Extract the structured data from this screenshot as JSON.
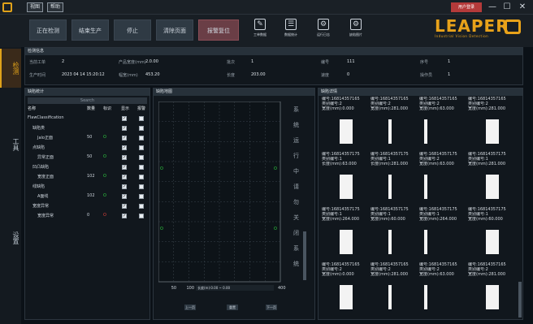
{
  "titlebar": {
    "menu_1": "视图",
    "menu_2": "帮助",
    "user_btn": "用户登录"
  },
  "toolbar": {
    "buttons": [
      "正在检测",
      "结束生产",
      "停止",
      "清除页面",
      "报警复位"
    ],
    "icons": [
      {
        "label": "工单数据",
        "name": "work-order-icon"
      },
      {
        "label": "数据统计",
        "name": "stats-icon"
      },
      {
        "label": "运行日志",
        "name": "log-icon"
      },
      {
        "label": "缺陷图片",
        "name": "defect-image-icon"
      }
    ],
    "brand": "LEAPER",
    "brand_sub": "Industrial Vision Detection",
    "accent": "#e8a21a"
  },
  "sidebar": {
    "tabs": [
      "检测",
      "工具",
      "设置"
    ]
  },
  "info": {
    "title": "检测信息",
    "row1": [
      {
        "k": "当前工单",
        "v": "2"
      },
      {
        "k": "产品宽度(mm)",
        "v": "2.0.00"
      },
      {
        "k": "批次",
        "v": "1"
      },
      {
        "k": "编号",
        "v": "111"
      },
      {
        "k": "序号",
        "v": "1"
      }
    ],
    "row2": [
      {
        "k": "生产时间",
        "v": "2023 04 14 15:20:12"
      },
      {
        "k": "幅宽(mm)",
        "v": "453.20"
      },
      {
        "k": "长度",
        "v": "203.00"
      },
      {
        "k": "速度",
        "v": "0"
      },
      {
        "k": "操作员",
        "v": "1"
      }
    ]
  },
  "stats": {
    "title": "缺陷统计",
    "search": "Search",
    "cols": [
      "名称",
      "数量",
      "标识",
      "显示",
      "报警"
    ],
    "rows": [
      {
        "indent": 0,
        "name": "FlawClassification",
        "count": "",
        "flag": "",
        "show": "✓",
        "alarm": ""
      },
      {
        "indent": 1,
        "name": "缺陷类",
        "count": "",
        "flag": "",
        "show": "✓",
        "alarm": ""
      },
      {
        "indent": 2,
        "name": "Jalo正面",
        "count": "50",
        "flag": "O",
        "flagc": "#2ecc40",
        "show": "✓",
        "alarm": ""
      },
      {
        "indent": 1,
        "name": "点缺陷",
        "count": "",
        "flag": "",
        "show": "✓",
        "alarm": ""
      },
      {
        "indent": 2,
        "name": "异常正面",
        "count": "50",
        "flag": "O",
        "flagc": "#2ecc40",
        "show": "✓",
        "alarm": ""
      },
      {
        "indent": 1,
        "name": "凹凸缺陷",
        "count": "",
        "flag": "",
        "show": "✓",
        "alarm": ""
      },
      {
        "indent": 2,
        "name": "宽度正面",
        "count": "102",
        "flag": "O",
        "flagc": "#2ecc40",
        "show": "✓",
        "alarm": ""
      },
      {
        "indent": 1,
        "name": "线缺陷",
        "count": "",
        "flag": "",
        "show": "✓",
        "alarm": ""
      },
      {
        "indent": 2,
        "name": "A面线",
        "count": "102",
        "flag": "O",
        "flagc": "#2ecc40",
        "show": "✓",
        "alarm": ""
      },
      {
        "indent": 1,
        "name": "宽度异常",
        "count": "",
        "flag": "",
        "show": "✓",
        "alarm": ""
      },
      {
        "indent": 2,
        "name": "宽度异常",
        "count": "0",
        "flag": "O",
        "flagc": "#e0413a",
        "show": "✓",
        "alarm": ""
      }
    ]
  },
  "map": {
    "title": "缺陷地图",
    "xticks": [
      "0",
      "50",
      "100",
      "150",
      "200",
      "250",
      "300",
      "350",
      "400"
    ],
    "marker_o": "O",
    "side_labels": [
      "系",
      "统",
      "运",
      "行",
      "中",
      "请",
      "勿",
      "关",
      "闭",
      "系",
      "统"
    ],
    "readout": "长度(m):0.00 ~ 0.00",
    "btns": [
      "上一页",
      "重置",
      "下一页"
    ]
  },
  "gallery": {
    "title": "缺陷详情",
    "cells": [
      [
        "编号:16814357165",
        "类别编号:2",
        "宽度(mm):0.000"
      ],
      [
        "编号:16814357165",
        "类别编号:2",
        "宽度(mm):281.000"
      ],
      [
        "编号:16814357165",
        "类别编号:2",
        "宽度(mm):63.000"
      ],
      [
        "编号:16814357165",
        "类别编号:2",
        "宽度(mm):281.000"
      ],
      [
        "编号:16814357175",
        "类别编号:1",
        "长度(mm):63.000"
      ],
      [
        "编号:16814357175",
        "类别编号:1",
        "长度(mm):281.000"
      ],
      [
        "编号:16814357175",
        "类别编号:2",
        "宽度(mm):63.000"
      ],
      [
        "编号:16814357175",
        "类别编号:1",
        "宽度(mm):281.000"
      ],
      [
        "编号:16814357175",
        "类别编号:1",
        "宽度(mm):264.000"
      ],
      [
        "编号:16814357175",
        "类别编号:1",
        "宽度(mm):60.000"
      ],
      [
        "编号:16814357175",
        "类别编号:1",
        "宽度(mm):264.000"
      ],
      [
        "编号:16814357175",
        "类别编号:1",
        "宽度(mm):60.000"
      ],
      [
        "编号:16814357165",
        "类别编号:2",
        "宽度(mm):0.000"
      ],
      [
        "编号:16814357165",
        "类别编号:2",
        "宽度(mm):281.000"
      ],
      [
        "编号:16814357165",
        "类别编号:2",
        "宽度(mm):63.000"
      ],
      [
        "编号:16814357165",
        "类别编号:2",
        "宽度(mm):281.000"
      ]
    ]
  }
}
